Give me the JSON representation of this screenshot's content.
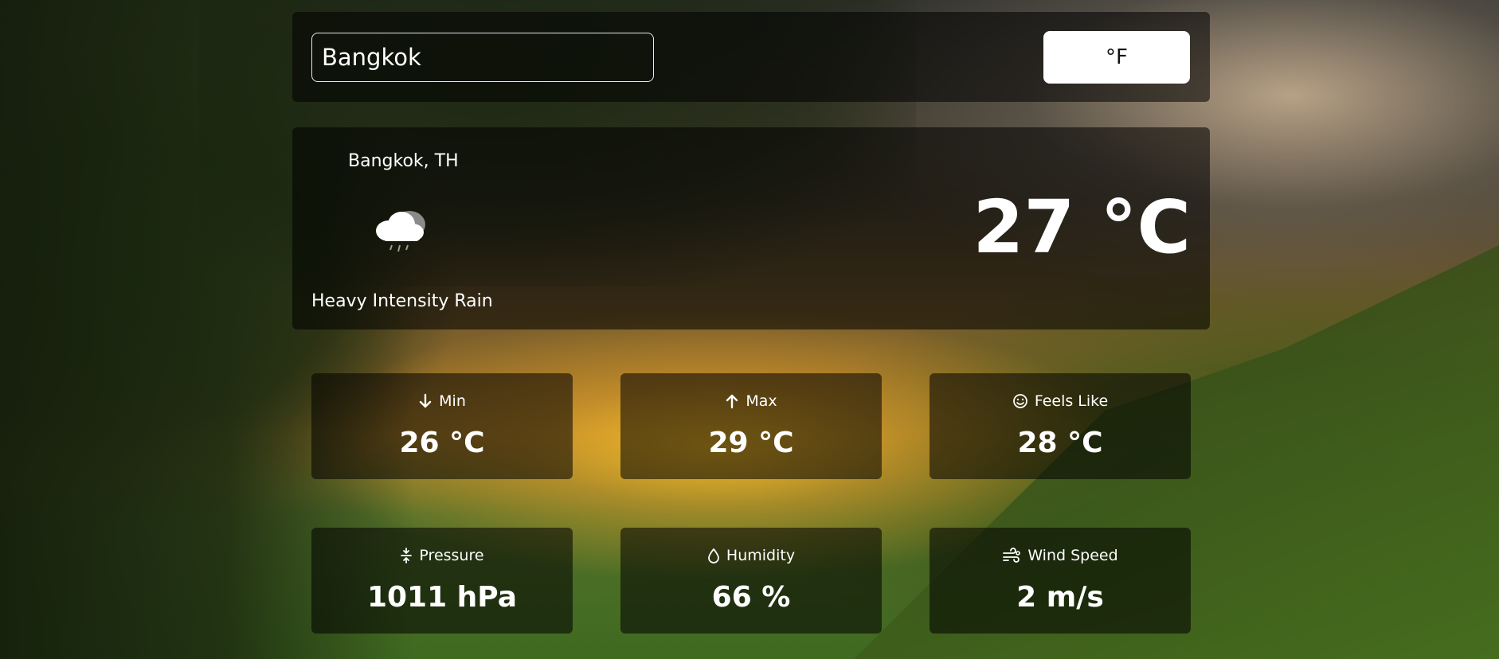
{
  "search": {
    "value": "Bangkok"
  },
  "unit_toggle": {
    "label": "°F"
  },
  "current": {
    "location": "Bangkok, TH",
    "icon": "heavy-rain-cloud-icon",
    "description": "Heavy Intensity Rain",
    "temperature": "27 °C"
  },
  "details": {
    "min": {
      "label": "Min",
      "value": "26 °C",
      "icon": "arrow-down-icon"
    },
    "max": {
      "label": "Max",
      "value": "29 °C",
      "icon": "arrow-up-icon"
    },
    "feels_like": {
      "label": "Feels Like",
      "value": "28 °C",
      "icon": "smiley-icon"
    },
    "pressure": {
      "label": "Pressure",
      "value": "1011 hPa",
      "icon": "pressure-icon"
    },
    "humidity": {
      "label": "Humidity",
      "value": "66 %",
      "icon": "droplet-icon"
    },
    "wind_speed": {
      "label": "Wind Speed",
      "value": "2 m/s",
      "icon": "wind-icon"
    }
  }
}
